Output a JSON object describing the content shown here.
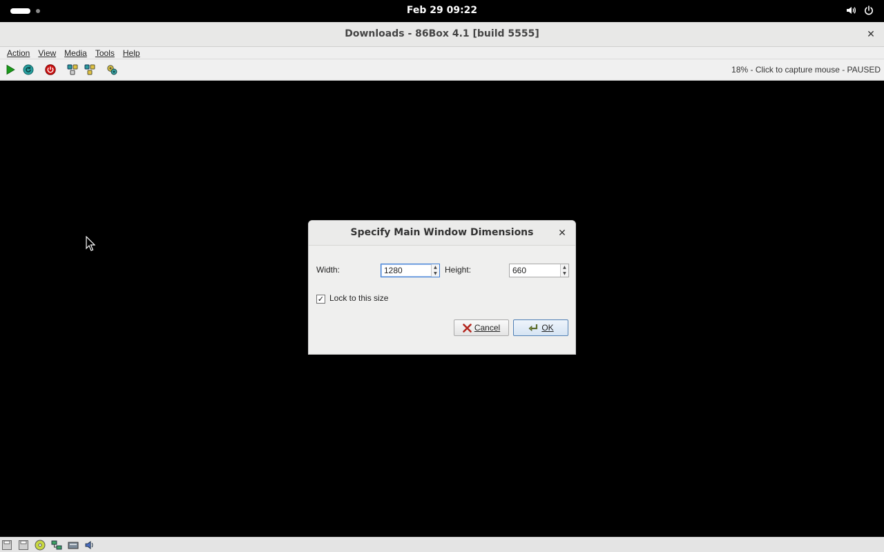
{
  "topbar": {
    "clock": "Feb 29  09:22",
    "icons": [
      "volume-icon",
      "power-icon"
    ]
  },
  "window": {
    "title": "Downloads - 86Box 4.1 [build 5555]",
    "close_glyph": "✕"
  },
  "menubar": {
    "items": [
      "Action",
      "View",
      "Media",
      "Tools",
      "Help"
    ]
  },
  "toolbar": {
    "buttons": [
      "play-icon",
      "reset-icon",
      "power-off-icon",
      "ctrl-alt-del-icon",
      "ctrl-alt-esc-icon",
      "settings-icon"
    ],
    "status": "18% - Click to capture mouse - PAUSED"
  },
  "dialog": {
    "title": "Specify Main Window Dimensions",
    "close_glyph": "✕",
    "width_label": "Width:",
    "width_value": "1280",
    "height_label": "Height:",
    "height_value": "660",
    "lock_label": "Lock to this size",
    "lock_checked": true,
    "check_glyph": "✓",
    "cancel_label": "Cancel",
    "ok_label": "OK"
  },
  "statusbar": {
    "icons": [
      "floppy-1-icon",
      "floppy-2-icon",
      "cdrom-icon",
      "network-icon",
      "hdd-icon",
      "sound-icon"
    ]
  },
  "colors": {
    "desktop": "#000000",
    "play_green": "#1a9a1a",
    "reset_teal": "#1f8a8a",
    "power_red": "#cc1111",
    "cancel_red": "#b3261e",
    "ok_border": "#4f7fb5"
  }
}
